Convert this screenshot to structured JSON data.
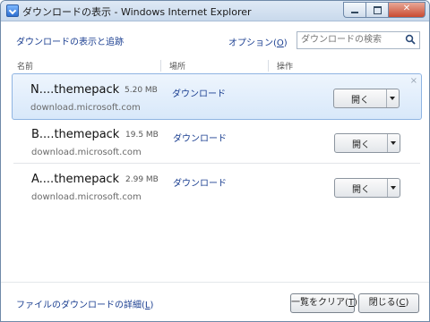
{
  "window": {
    "title": "ダウンロードの表示 - Windows Internet Explorer",
    "min_glyph": "",
    "max_glyph": "",
    "close_glyph": "✕"
  },
  "header": {
    "link_label": "ダウンロードの表示と追跡",
    "options_label": "オプション(",
    "options_accel": "O",
    "options_suffix": ")",
    "search_placeholder": "ダウンロードの検索"
  },
  "columns": {
    "name": "名前",
    "location": "場所",
    "action": "操作"
  },
  "downloads": [
    {
      "name": "N....themepack",
      "size": "5.20 MB",
      "location": "ダウンロード",
      "source": "download.microsoft.com",
      "action": "開く",
      "selected": true,
      "remove_glyph": "×"
    },
    {
      "name": "B....themepack",
      "size": "19.5 MB",
      "location": "ダウンロード",
      "source": "download.microsoft.com",
      "action": "開く",
      "selected": false
    },
    {
      "name": "A....themepack",
      "size": "2.99 MB",
      "location": "ダウンロード",
      "source": "download.microsoft.com",
      "action": "開く",
      "selected": false
    }
  ],
  "footer": {
    "details_label": "ファイルのダウンロードの詳細(",
    "details_accel": "L",
    "details_suffix": ")",
    "clear_label": "一覧をクリア(",
    "clear_accel": "T",
    "clear_suffix": ")",
    "close_label": "閉じる(",
    "close_accel": "C",
    "close_suffix": ")"
  },
  "colors": {
    "link": "#1b3f91",
    "selection": "#d8e8fa",
    "titlebar": "#c9d9ec"
  }
}
